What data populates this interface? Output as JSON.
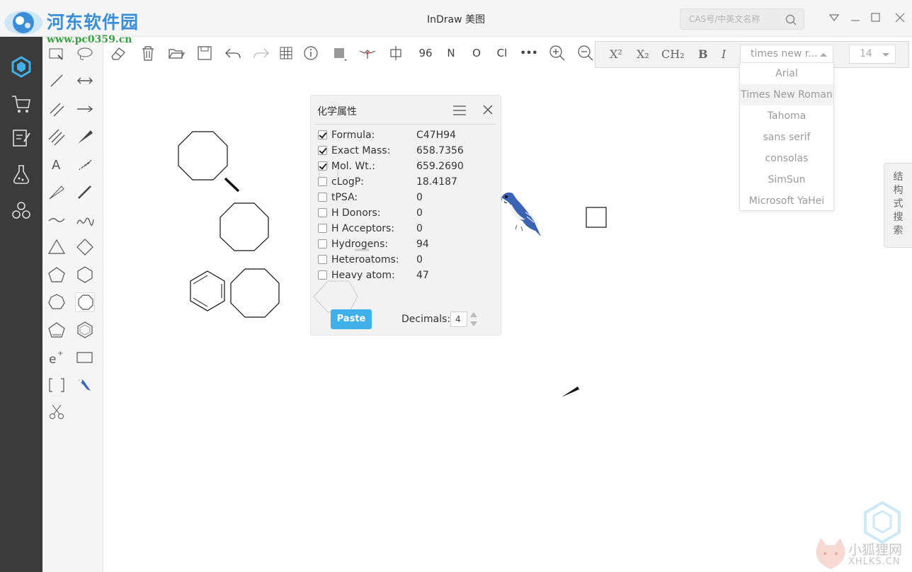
{
  "brand": {
    "logo_text": "河东软件园",
    "logo_url": "www.pc0359.cn"
  },
  "window": {
    "title": "InDraw 美图",
    "search_placeholder": "CAS号/中英文名称"
  },
  "toolbar": {
    "atom_count_label": "96",
    "atom_n": "N",
    "atom_o": "O",
    "atom_cl": "Cl",
    "more": "•••"
  },
  "format_bar": {
    "superscript": "X²",
    "subscript": "X₂",
    "ch2": "CH₂",
    "bold": "B",
    "italic": "I",
    "font_value": "times new r...",
    "size_value": "14"
  },
  "font_options": [
    "Arial",
    "Times New Roman",
    "Tahoma",
    "sans serif",
    "consolas",
    "SimSun",
    "Microsoft YaHei"
  ],
  "side_tab": [
    "结",
    "构",
    "式",
    "搜",
    "索"
  ],
  "dialog": {
    "title": "化学属性",
    "properties": [
      {
        "name": "Formula:",
        "value": "C47H94",
        "checked": true
      },
      {
        "name": "Exact Mass:",
        "value": "658.7356",
        "checked": true
      },
      {
        "name": "Mol. Wt.:",
        "value": "659.2690",
        "checked": true
      },
      {
        "name": "cLogP:",
        "value": "18.4187",
        "checked": false
      },
      {
        "name": "tPSA:",
        "value": "0",
        "checked": false
      },
      {
        "name": "H Donors:",
        "value": "0",
        "checked": false
      },
      {
        "name": "H Acceptors:",
        "value": "0",
        "checked": false
      },
      {
        "name": "Hydrogens:",
        "value": "94",
        "checked": false
      },
      {
        "name": "Heteroatoms:",
        "value": "0",
        "checked": false
      },
      {
        "name": "Heavy atom:",
        "value": "47",
        "checked": false
      }
    ],
    "paste_label": "Paste",
    "decimals_label": "Decimals:",
    "decimals_value": "4"
  },
  "watermark": {
    "line1": "小狐狸网",
    "line2": "XHLKS.CN"
  },
  "colors": {
    "accent": "#3fb0ea",
    "leftbar": "#3b3b3b",
    "logo_blue": "#3a8ed8"
  }
}
